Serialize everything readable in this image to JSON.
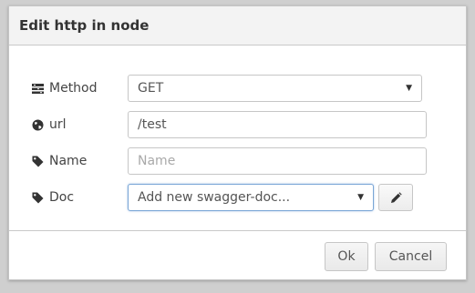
{
  "dialog": {
    "title": "Edit http in node"
  },
  "form": {
    "method": {
      "label": "Method",
      "value": "GET",
      "icon": "tasks-icon"
    },
    "url": {
      "label": "url",
      "value": "/test",
      "icon": "globe-icon"
    },
    "name": {
      "label": "Name",
      "value": "",
      "placeholder": "Name",
      "icon": "tag-icon"
    },
    "doc": {
      "label": "Doc",
      "value": "Add new swagger-doc...",
      "icon": "tag-icon",
      "edit_icon": "pencil-icon"
    }
  },
  "footer": {
    "ok_label": "Ok",
    "cancel_label": "Cancel"
  },
  "colors": {
    "title_bg": "#f3f3f3",
    "focus_border": "#7aa6d6",
    "button_bg": "#ececec"
  }
}
